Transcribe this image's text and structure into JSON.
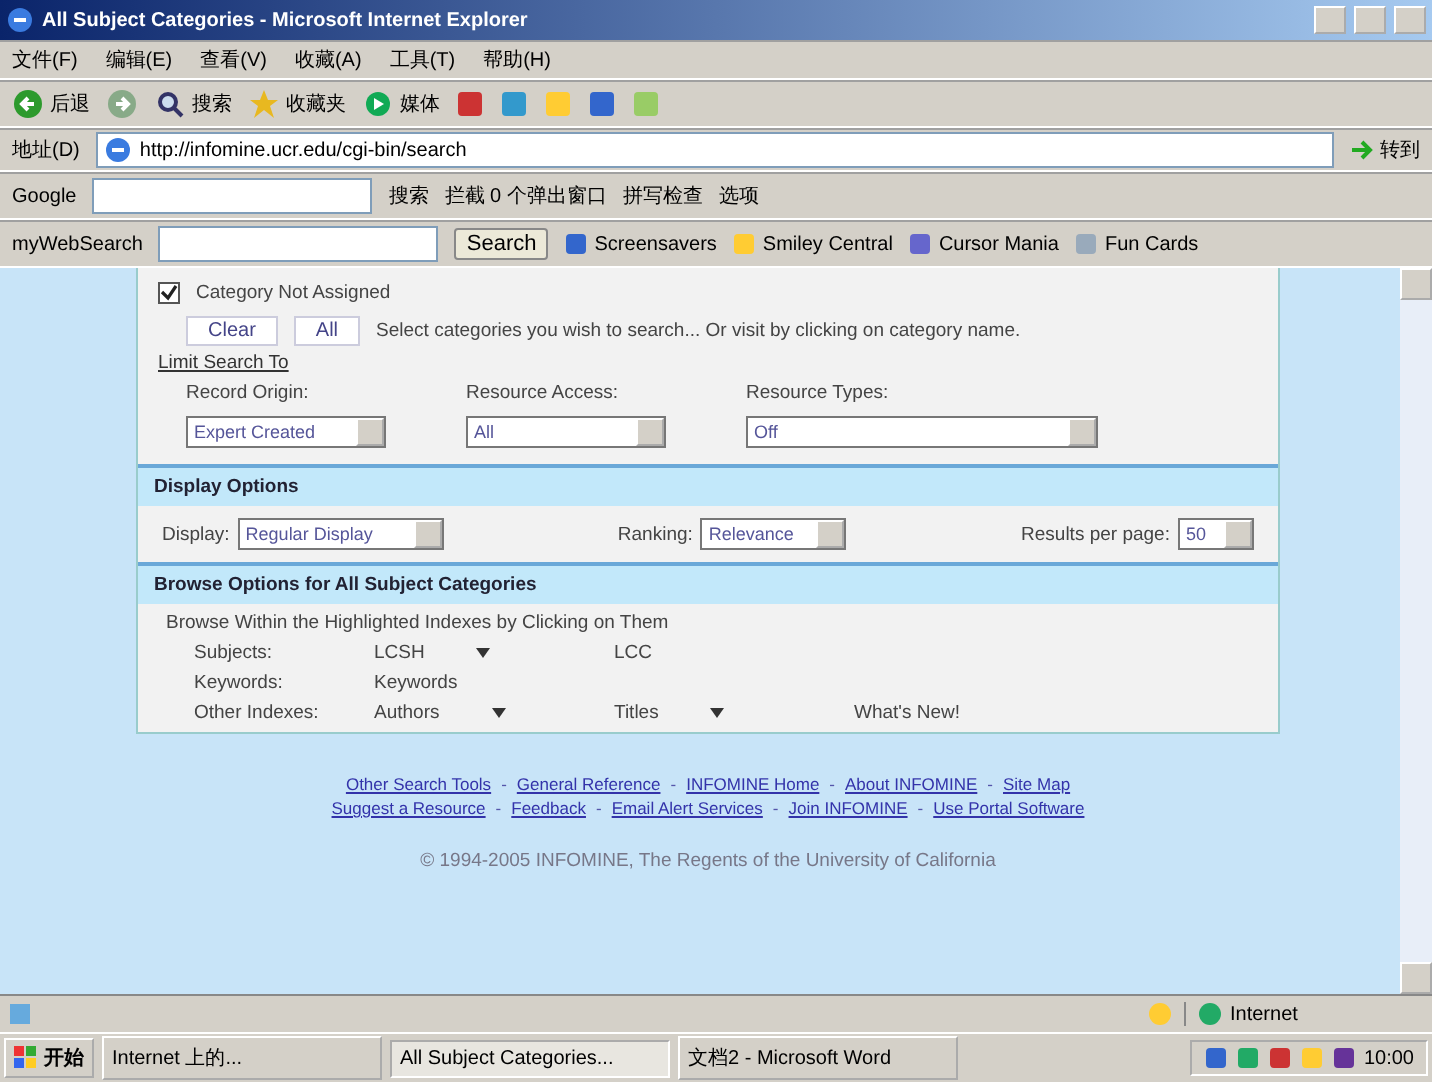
{
  "window": {
    "title": "All Subject Categories - Microsoft Internet Explorer"
  },
  "menu": [
    "文件(F)",
    "编辑(E)",
    "查看(V)",
    "收藏(A)",
    "工具(T)",
    "帮助(H)"
  ],
  "toolbar": [
    {
      "label": "后退",
      "kind": "back"
    },
    {
      "kind": "forward"
    },
    {
      "label": "搜索",
      "kind": "search"
    },
    {
      "label": "收藏夹",
      "kind": "favorites"
    },
    {
      "label": "媒体",
      "kind": "media"
    }
  ],
  "address": {
    "label": "地址(D)",
    "url": "http://infomine.ucr.edu/cgi-bin/search",
    "go": "转到"
  },
  "google_bar": {
    "label": "Google",
    "search": "搜索",
    "items": [
      "拦截 0 个弹出窗口",
      "拼写检查",
      "选项"
    ]
  },
  "search_bar": {
    "label": "myWebSearch",
    "button": "Search",
    "links": [
      "Screensavers",
      "Smiley Central",
      "Cursor Mania",
      "Fun Cards"
    ]
  },
  "page": {
    "category_checkbox": {
      "label": "Category Not Assigned",
      "checked": true
    },
    "buttons": [
      "Clear",
      "All"
    ],
    "hint": "Select categories you wish to search... Or visit by clicking on category name.",
    "limit_heading": "Limit Search To",
    "filters": [
      {
        "label": "Record Origin:",
        "value": "Expert Created",
        "kind": "narrow"
      },
      {
        "label": "Resource Access:",
        "value": "All",
        "kind": "narrow"
      },
      {
        "label": "Resource Types:",
        "value": "Off",
        "kind": "wide"
      }
    ],
    "display": {
      "heading": "Display Options",
      "fields": [
        {
          "label": "Display:",
          "value": "Regular Display"
        },
        {
          "label": "Ranking:",
          "value": "Relevance"
        },
        {
          "label": "Results per page:",
          "value": "50"
        }
      ]
    },
    "browse": {
      "heading": "Browse Options for All Subject Categories",
      "intro": "Browse Within the Highlighted Indexes by Clicking on Them",
      "rows": [
        {
          "label": "Subjects:",
          "links": [
            {
              "text": "LCSH",
              "menu": true
            },
            {
              "text": "LCC",
              "menu": false
            }
          ]
        },
        {
          "label": "Keywords:",
          "links": [
            {
              "text": "Keywords",
              "menu": false
            }
          ]
        },
        {
          "label": "Other Indexes:",
          "links": [
            {
              "text": "Authors",
              "menu": true
            },
            {
              "text": "Titles",
              "menu": true
            },
            {
              "text": "What's New!",
              "menu": false
            }
          ]
        }
      ]
    },
    "footer_links": [
      [
        {
          "kind": "link",
          "text": "Other Search Tools"
        },
        {
          "kind": "separator",
          "text": "-"
        },
        {
          "kind": "link",
          "text": "General Reference"
        },
        {
          "kind": "separator",
          "text": "-"
        },
        {
          "kind": "link",
          "text": "INFOMINE Home"
        },
        {
          "kind": "separator",
          "text": "-"
        },
        {
          "kind": "link",
          "text": "About INFOMINE"
        },
        {
          "kind": "separator",
          "text": "-"
        },
        {
          "kind": "link",
          "text": "Site Map"
        }
      ],
      [
        {
          "kind": "link",
          "text": "Suggest a Resource"
        },
        {
          "kind": "separator",
          "text": "-"
        },
        {
          "kind": "link",
          "text": "Feedback"
        },
        {
          "kind": "separator",
          "text": "-"
        },
        {
          "kind": "link",
          "text": "Email Alert Services"
        },
        {
          "kind": "separator",
          "text": "-"
        },
        {
          "kind": "link",
          "text": "Join INFOMINE"
        },
        {
          "kind": "separator",
          "text": "-"
        },
        {
          "kind": "link",
          "text": "Use Portal Software"
        }
      ]
    ],
    "copyright": "© 1994-2005 INFOMINE, The Regents of the University of California"
  },
  "status_bar": {
    "zone": "Internet"
  },
  "taskbar": {
    "start": "开始",
    "tasks": [
      {
        "label": "Internet 上的...",
        "selected": false
      },
      {
        "label": "All Subject Categories...",
        "selected": true
      },
      {
        "label": "文档2 - Microsoft Word",
        "selected": false
      }
    ],
    "clock": "10:00"
  }
}
